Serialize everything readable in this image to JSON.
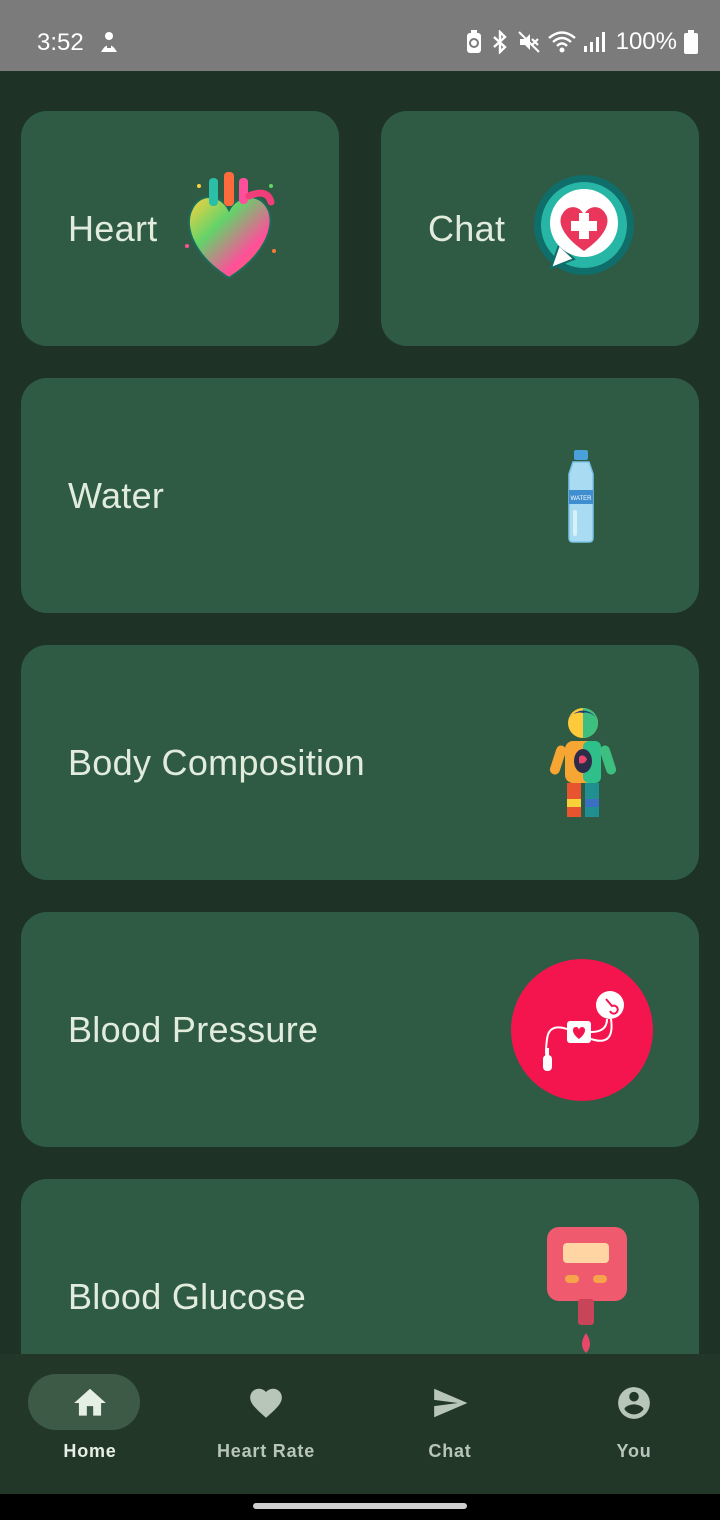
{
  "status_bar": {
    "time": "3:52",
    "battery": "100%",
    "icons": [
      "android-notification-icon",
      "battery-saver-icon",
      "bluetooth-icon",
      "mute-icon",
      "wifi-icon",
      "signal-icon",
      "battery-icon"
    ]
  },
  "cards": {
    "heart": {
      "label": "Heart",
      "icon": "colorful-heart-icon"
    },
    "chat": {
      "label": "Chat",
      "icon": "medical-chat-bubble-icon"
    },
    "water": {
      "label": "Water",
      "icon": "water-bottle-icon",
      "bottle_text": "WATER"
    },
    "body": {
      "label": "Body Composition",
      "icon": "body-anatomy-icon"
    },
    "pressure": {
      "label": "Blood Pressure",
      "icon": "blood-pressure-monitor-icon"
    },
    "glucose": {
      "label": "Blood Glucose",
      "icon": "glucose-meter-icon"
    }
  },
  "nav": {
    "active": "home",
    "items": [
      {
        "label": "Home",
        "icon": "home-icon"
      },
      {
        "label": "Heart Rate",
        "icon": "heart-icon"
      },
      {
        "label": "Chat",
        "icon": "send-icon"
      },
      {
        "label": "You",
        "icon": "account-circle-icon"
      }
    ]
  },
  "colors": {
    "background": "#1e3325",
    "card": "#2f5b44",
    "nav_background": "#233729",
    "active_pill": "#3d5a47",
    "label_text": "#e2ecdd",
    "blood_pressure_red": "#f5154e"
  }
}
